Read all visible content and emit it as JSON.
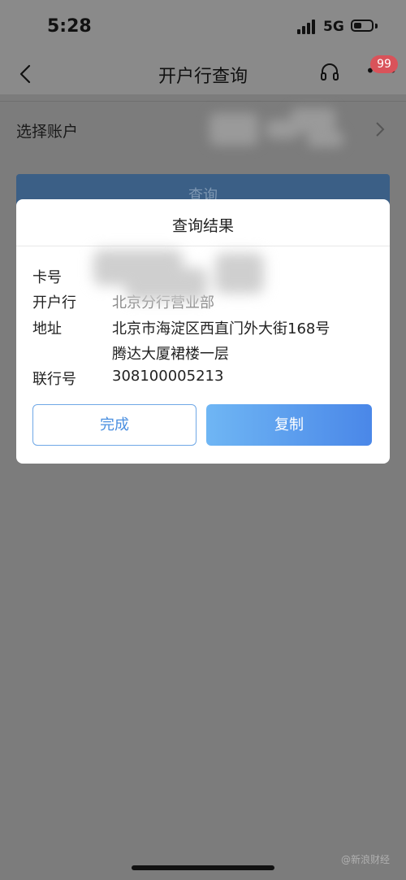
{
  "status_bar": {
    "time": "5:28",
    "network": "5G",
    "battery_level": 0.45
  },
  "nav": {
    "title": "开户行查询",
    "badge_count": "99"
  },
  "account": {
    "label": "选择账户"
  },
  "query_button": {
    "label": "查询"
  },
  "dialog": {
    "title": "查询结果",
    "fields": [
      {
        "label": "卡号",
        "value": ""
      },
      {
        "label": "开户行",
        "value": "北京分行营业部"
      },
      {
        "label": "地址",
        "value": "北京市海淀区西直门外大街168号",
        "value_line2": "腾达大厦裙楼一层"
      },
      {
        "label": "联行号",
        "value": "308100005213"
      }
    ],
    "done_label": "完成",
    "copy_label": "复制"
  },
  "watermark": "@新浪财经"
}
